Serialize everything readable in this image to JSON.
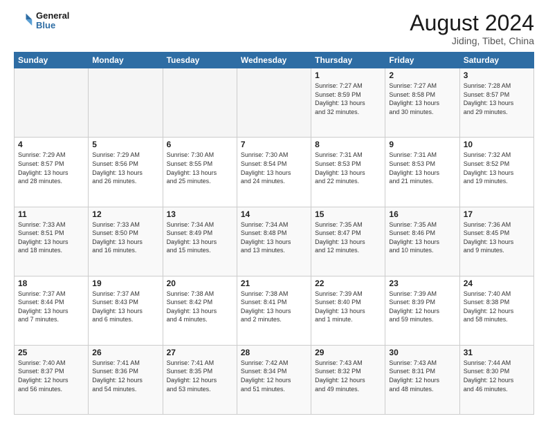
{
  "logo": {
    "line1": "General",
    "line2": "Blue"
  },
  "title": "August 2024",
  "subtitle": "Jiding, Tibet, China",
  "weekdays": [
    "Sunday",
    "Monday",
    "Tuesday",
    "Wednesday",
    "Thursday",
    "Friday",
    "Saturday"
  ],
  "weeks": [
    [
      {
        "day": "",
        "info": ""
      },
      {
        "day": "",
        "info": ""
      },
      {
        "day": "",
        "info": ""
      },
      {
        "day": "",
        "info": ""
      },
      {
        "day": "1",
        "info": "Sunrise: 7:27 AM\nSunset: 8:59 PM\nDaylight: 13 hours\nand 32 minutes."
      },
      {
        "day": "2",
        "info": "Sunrise: 7:27 AM\nSunset: 8:58 PM\nDaylight: 13 hours\nand 30 minutes."
      },
      {
        "day": "3",
        "info": "Sunrise: 7:28 AM\nSunset: 8:57 PM\nDaylight: 13 hours\nand 29 minutes."
      }
    ],
    [
      {
        "day": "4",
        "info": "Sunrise: 7:29 AM\nSunset: 8:57 PM\nDaylight: 13 hours\nand 28 minutes."
      },
      {
        "day": "5",
        "info": "Sunrise: 7:29 AM\nSunset: 8:56 PM\nDaylight: 13 hours\nand 26 minutes."
      },
      {
        "day": "6",
        "info": "Sunrise: 7:30 AM\nSunset: 8:55 PM\nDaylight: 13 hours\nand 25 minutes."
      },
      {
        "day": "7",
        "info": "Sunrise: 7:30 AM\nSunset: 8:54 PM\nDaylight: 13 hours\nand 24 minutes."
      },
      {
        "day": "8",
        "info": "Sunrise: 7:31 AM\nSunset: 8:53 PM\nDaylight: 13 hours\nand 22 minutes."
      },
      {
        "day": "9",
        "info": "Sunrise: 7:31 AM\nSunset: 8:53 PM\nDaylight: 13 hours\nand 21 minutes."
      },
      {
        "day": "10",
        "info": "Sunrise: 7:32 AM\nSunset: 8:52 PM\nDaylight: 13 hours\nand 19 minutes."
      }
    ],
    [
      {
        "day": "11",
        "info": "Sunrise: 7:33 AM\nSunset: 8:51 PM\nDaylight: 13 hours\nand 18 minutes."
      },
      {
        "day": "12",
        "info": "Sunrise: 7:33 AM\nSunset: 8:50 PM\nDaylight: 13 hours\nand 16 minutes."
      },
      {
        "day": "13",
        "info": "Sunrise: 7:34 AM\nSunset: 8:49 PM\nDaylight: 13 hours\nand 15 minutes."
      },
      {
        "day": "14",
        "info": "Sunrise: 7:34 AM\nSunset: 8:48 PM\nDaylight: 13 hours\nand 13 minutes."
      },
      {
        "day": "15",
        "info": "Sunrise: 7:35 AM\nSunset: 8:47 PM\nDaylight: 13 hours\nand 12 minutes."
      },
      {
        "day": "16",
        "info": "Sunrise: 7:35 AM\nSunset: 8:46 PM\nDaylight: 13 hours\nand 10 minutes."
      },
      {
        "day": "17",
        "info": "Sunrise: 7:36 AM\nSunset: 8:45 PM\nDaylight: 13 hours\nand 9 minutes."
      }
    ],
    [
      {
        "day": "18",
        "info": "Sunrise: 7:37 AM\nSunset: 8:44 PM\nDaylight: 13 hours\nand 7 minutes."
      },
      {
        "day": "19",
        "info": "Sunrise: 7:37 AM\nSunset: 8:43 PM\nDaylight: 13 hours\nand 6 minutes."
      },
      {
        "day": "20",
        "info": "Sunrise: 7:38 AM\nSunset: 8:42 PM\nDaylight: 13 hours\nand 4 minutes."
      },
      {
        "day": "21",
        "info": "Sunrise: 7:38 AM\nSunset: 8:41 PM\nDaylight: 13 hours\nand 2 minutes."
      },
      {
        "day": "22",
        "info": "Sunrise: 7:39 AM\nSunset: 8:40 PM\nDaylight: 13 hours\nand 1 minute."
      },
      {
        "day": "23",
        "info": "Sunrise: 7:39 AM\nSunset: 8:39 PM\nDaylight: 12 hours\nand 59 minutes."
      },
      {
        "day": "24",
        "info": "Sunrise: 7:40 AM\nSunset: 8:38 PM\nDaylight: 12 hours\nand 58 minutes."
      }
    ],
    [
      {
        "day": "25",
        "info": "Sunrise: 7:40 AM\nSunset: 8:37 PM\nDaylight: 12 hours\nand 56 minutes."
      },
      {
        "day": "26",
        "info": "Sunrise: 7:41 AM\nSunset: 8:36 PM\nDaylight: 12 hours\nand 54 minutes."
      },
      {
        "day": "27",
        "info": "Sunrise: 7:41 AM\nSunset: 8:35 PM\nDaylight: 12 hours\nand 53 minutes."
      },
      {
        "day": "28",
        "info": "Sunrise: 7:42 AM\nSunset: 8:34 PM\nDaylight: 12 hours\nand 51 minutes."
      },
      {
        "day": "29",
        "info": "Sunrise: 7:43 AM\nSunset: 8:32 PM\nDaylight: 12 hours\nand 49 minutes."
      },
      {
        "day": "30",
        "info": "Sunrise: 7:43 AM\nSunset: 8:31 PM\nDaylight: 12 hours\nand 48 minutes."
      },
      {
        "day": "31",
        "info": "Sunrise: 7:44 AM\nSunset: 8:30 PM\nDaylight: 12 hours\nand 46 minutes."
      }
    ]
  ]
}
